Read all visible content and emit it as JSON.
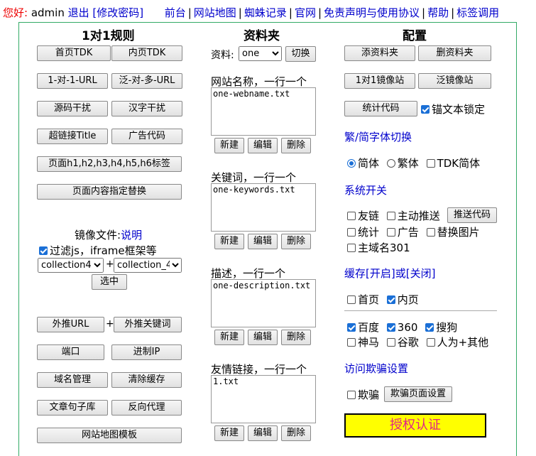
{
  "topbar": {
    "greeting": "您好:",
    "user": "admin",
    "logout": "退出",
    "change_pwd": "[修改密码]",
    "links": [
      "前台",
      "网站地图",
      "蜘蛛记录",
      "官网",
      "免责声明与使用协议",
      "帮助",
      "标签调用"
    ]
  },
  "col1": {
    "title": "1对1规则",
    "buttons": [
      "首页TDK",
      "内页TDK",
      "1-对-1-URL",
      "泛-对-多-URL",
      "源码干扰",
      "汉字干扰",
      "超链接Title",
      "广告代码"
    ],
    "wide_buttons": [
      "页面h1,h2,h3,h4,h5,h6标签",
      "页面内容指定替换"
    ],
    "mirror_label": "镜像文件:",
    "mirror_help": "说明",
    "filter_label": "过滤js，iframe框架等",
    "select_a": "collection4",
    "select_b": "collection_4",
    "plus": "+",
    "select_btn": "选中",
    "push_url": "外推URL",
    "push_kw": "外推关键词",
    "lower_buttons": [
      "端口",
      "进制IP",
      "域名管理",
      "清除缓存",
      "文章句子库",
      "反向代理"
    ],
    "sitemap_tpl": "网站地图模板"
  },
  "col2": {
    "title": "资料夹",
    "data_label": "资料:",
    "data_select": "one",
    "switch_btn": "切换",
    "sections": [
      {
        "label": "网站名称，一行一个",
        "value": "one-webname.txt"
      },
      {
        "label": "关键词，一行一个",
        "value": "one-keywords.txt"
      },
      {
        "label": "描述，一行一个",
        "value": "one-description.txt"
      },
      {
        "label": "友情链接，一行一个",
        "value": "1.txt"
      }
    ],
    "new": "新建",
    "edit": "编辑",
    "del": "删除"
  },
  "col3": {
    "title": "配置",
    "add_folder": "添资料夹",
    "del_folder": "删资料夹",
    "mirror11": "1对1镜像站",
    "mirror_pan": "泛镜像站",
    "stats_code": "统计代码",
    "anchor_lock": "锚文本锁定",
    "font_switch": "繁/简字体切换",
    "simp": "简体",
    "trad": "繁体",
    "tdk_simp": "TDK简体",
    "switch_title": "系统开关",
    "friend_link": "友链",
    "active_push": "主动推送",
    "push_code": "推送代码",
    "stats": "统计",
    "ad": "广告",
    "replace_img": "替换图片",
    "main301": "主域名301",
    "cache_a": "缓存",
    "cache_on": "[开启]",
    "cache_or": "或",
    "cache_off": "[关闭]",
    "home": "首页",
    "inner": "内页",
    "engines": [
      "百度",
      "360",
      "搜狗",
      "神马",
      "谷歌",
      "人为+其他"
    ],
    "cloak_title": "访问欺骗设置",
    "cloak": "欺骗",
    "cloak_page": "欺骗页面设置",
    "auth": "授权认证"
  },
  "colors": {
    "accent": "#0000cc",
    "greeting": "#ee0000",
    "auth_bg": "#ffff00",
    "auth_fg": "#e0208a",
    "panel_border": "#33aa66"
  }
}
